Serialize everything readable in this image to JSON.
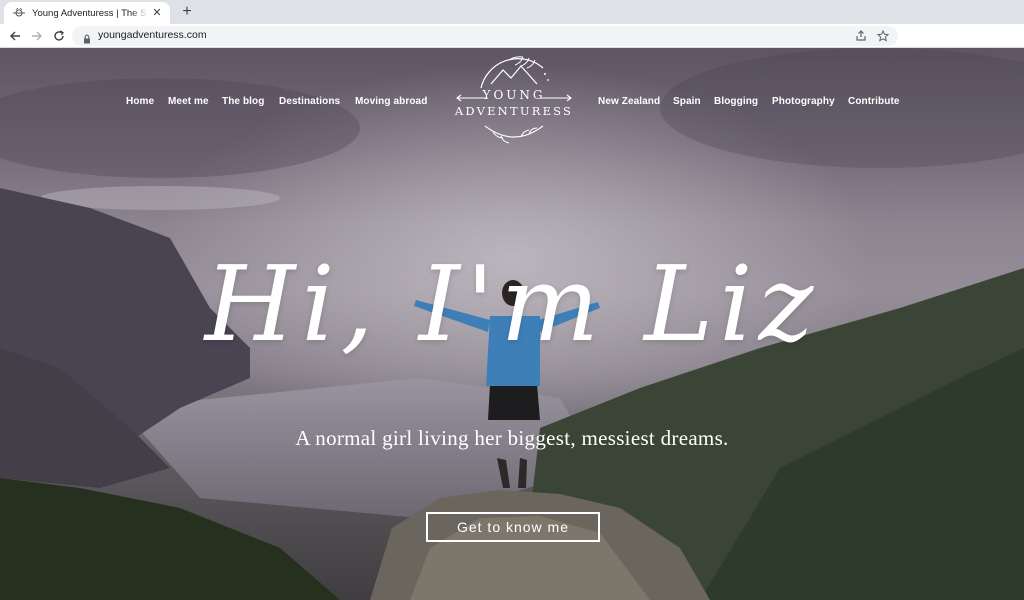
{
  "browser": {
    "tab_title": "Young Adventuress | The Solo Female Travel Blog",
    "url": "youngadventuress.com",
    "colors": {
      "chrome_bg": "#dee1e6",
      "toolbar_bg": "#ffffff",
      "omnibox_bg": "#f1f3f4"
    },
    "icons": [
      "favicon-icon",
      "close-icon",
      "new-tab-icon",
      "back-icon",
      "forward-icon",
      "reload-icon",
      "lock-icon",
      "share-icon",
      "bookmark-star-icon"
    ]
  },
  "site": {
    "nav_left": [
      "Home",
      "Meet me",
      "The blog",
      "Destinations",
      "Moving abroad"
    ],
    "nav_right": [
      "New Zealand",
      "Spain",
      "Blogging",
      "Photography",
      "Contribute"
    ],
    "logo": {
      "line1": "YOUNG",
      "line2": "ADVENTURESS"
    },
    "hero": {
      "headline": "Hi, I'm Liz",
      "tagline": "A normal girl living her biggest, messiest dreams.",
      "cta": "Get to know me"
    },
    "colors": {
      "text": "#ffffff",
      "sky_top": "#5d5563",
      "sky_mid": "#958e98",
      "mountain_green": "#2e3a2c"
    }
  }
}
